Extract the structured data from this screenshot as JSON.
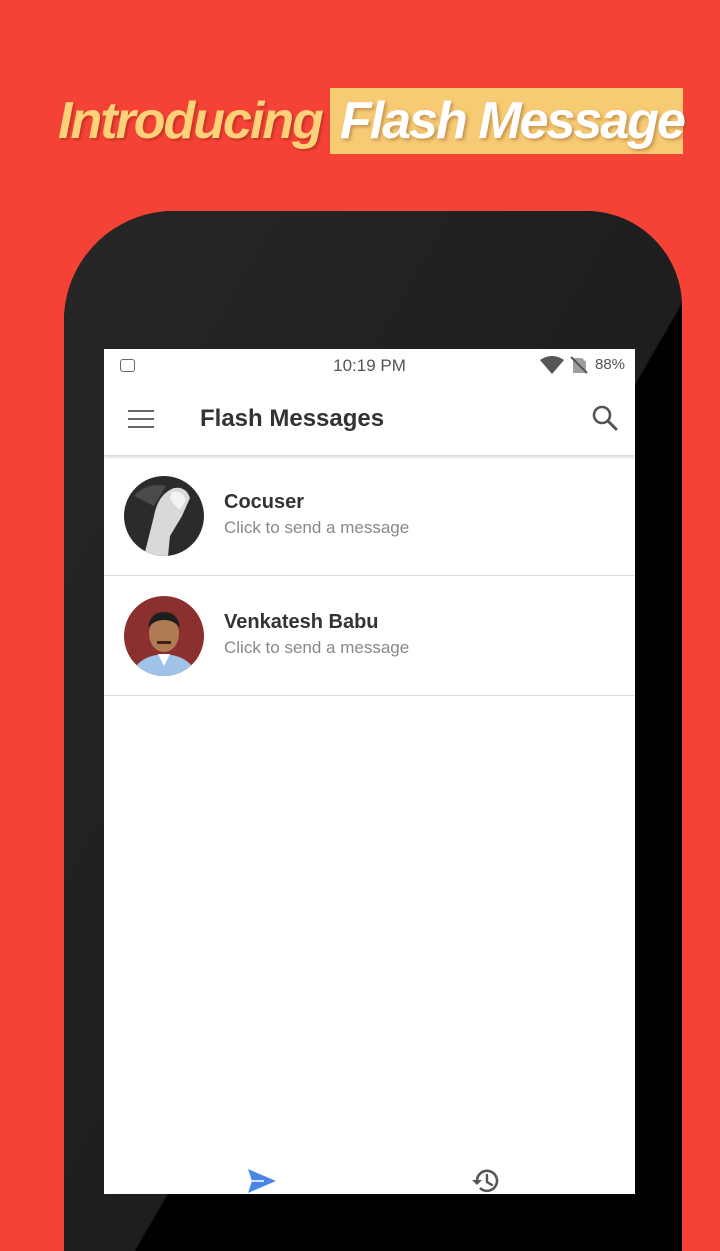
{
  "promo": {
    "intro": "Introducing",
    "product": "Flash Message"
  },
  "statusbar": {
    "time": "10:19 PM",
    "battery": "88%"
  },
  "toolbar": {
    "title": "Flash Messages"
  },
  "contacts": [
    {
      "name": "Cocuser",
      "subtitle": "Click to send a message"
    },
    {
      "name": "Venkatesh Babu",
      "subtitle": "Click to send a message"
    }
  ],
  "icons": {
    "menu": "hamburger-menu-icon",
    "search": "search-icon",
    "send": "send-icon",
    "history": "history-icon"
  },
  "colors": {
    "background": "#f44336",
    "promo_intro": "#ffd27a",
    "promo_highlight": "#f7ca74",
    "send_active": "#4a86e8"
  }
}
